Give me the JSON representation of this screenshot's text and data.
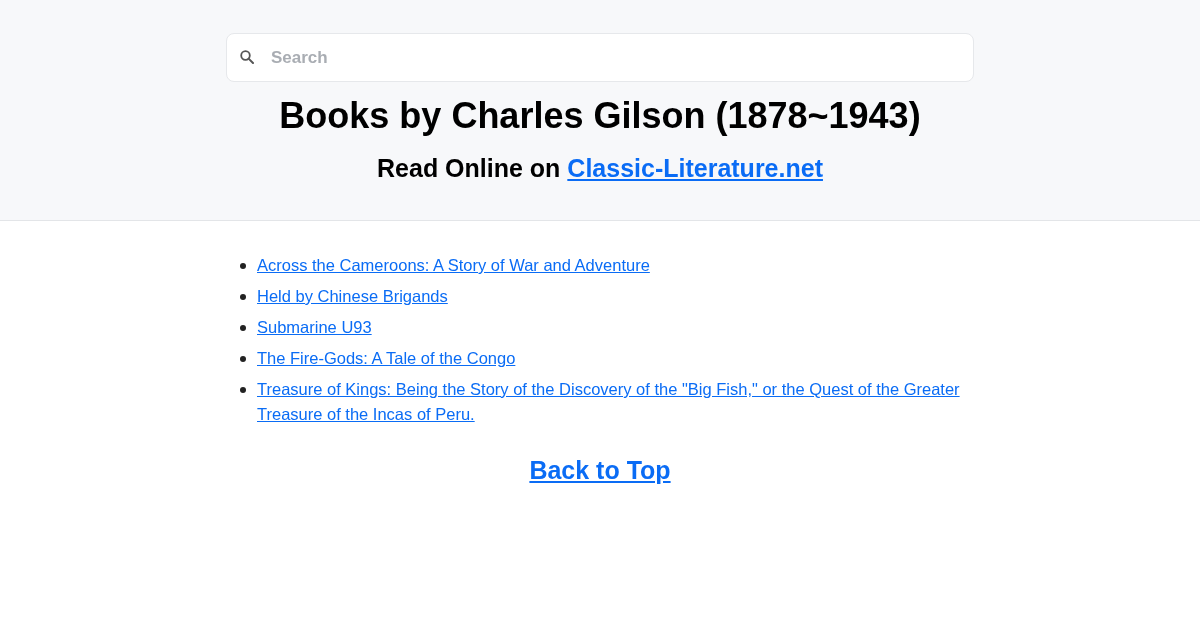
{
  "search": {
    "placeholder": "Search"
  },
  "title": "Books by Charles Gilson (1878~1943)",
  "subtitle": {
    "text": "Read Online on ",
    "link": "Classic-Literature.net"
  },
  "books": [
    "Across the Cameroons: A Story of War and Adventure",
    "Held by Chinese Brigands",
    "Submarine U93",
    "The Fire-Gods: A Tale of the Congo",
    "Treasure of Kings: Being the Story of the Discovery of the \"Big Fish,\" or the Quest of the Greater Treasure of the Incas of Peru."
  ],
  "back_to_top": "Back to Top"
}
